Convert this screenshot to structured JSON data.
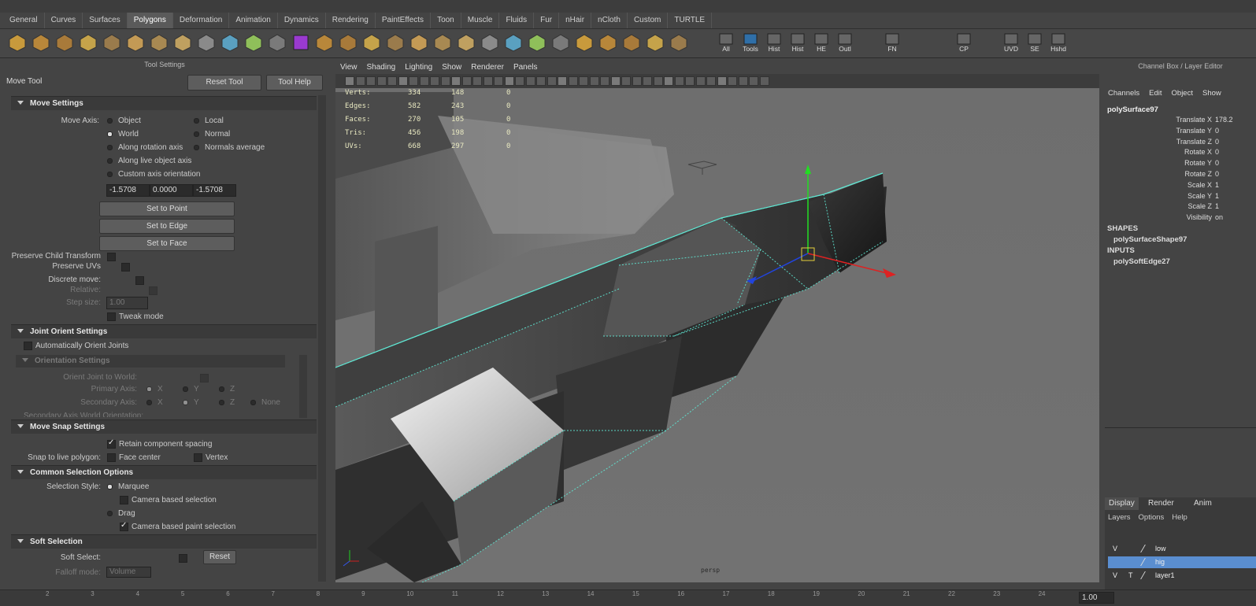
{
  "shelf_tabs": [
    "General",
    "Curves",
    "Surfaces",
    "Polygons",
    "Deformation",
    "Animation",
    "Dynamics",
    "Rendering",
    "PaintEffects",
    "Toon",
    "Muscle",
    "Fluids",
    "Fur",
    "nHair",
    "nCloth",
    "Custom",
    "TURTLE"
  ],
  "shelf_active": "Polygons",
  "shelf_labels": [
    "All",
    "Tools",
    "Hist",
    "Hist",
    "HE",
    "Outl",
    "FN",
    "CP",
    "UVD",
    "SE",
    "Hshd"
  ],
  "tool_settings": {
    "panel_title": "Tool Settings",
    "tool_name": "Move Tool",
    "reset_tool": "Reset Tool",
    "tool_help": "Tool Help",
    "move_settings": {
      "title": "Move Settings",
      "move_axis_label": "Move Axis:",
      "object": "Object",
      "local": "Local",
      "world": "World",
      "normal": "Normal",
      "along_rotation": "Along rotation axis",
      "normals_average": "Normals average",
      "along_live": "Along live object axis",
      "custom_axis": "Custom axis orientation",
      "v1": "-1.5708",
      "v2": "0.0000",
      "v3": "-1.5708",
      "set_to_point": "Set to Point",
      "set_to_edge": "Set to Edge",
      "set_to_face": "Set to Face",
      "preserve_child": "Preserve Child Transform",
      "preserve_uvs": "Preserve UVs",
      "discrete_move": "Discrete move:",
      "relative": "Relative:",
      "step_size": "Step size:",
      "step_value": "1.00",
      "tweak_mode": "Tweak mode"
    },
    "joint_orient": {
      "title": "Joint Orient Settings",
      "auto_orient": "Automatically Orient Joints",
      "orientation_settings": "Orientation Settings",
      "orient_world": "Orient Joint to World:",
      "primary_axis": "Primary Axis:",
      "secondary_axis": "Secondary Axis:",
      "x": "X",
      "y": "Y",
      "z": "Z",
      "none": "None",
      "secondary_world": "Secondary Axis World Orientation:"
    },
    "move_snap": {
      "title": "Move Snap Settings",
      "retain_spacing": "Retain component spacing",
      "snap_live": "Snap to live polygon:",
      "face_center": "Face center",
      "vertex": "Vertex"
    },
    "common_selection": {
      "title": "Common Selection Options",
      "selection_style": "Selection Style:",
      "marquee": "Marquee",
      "camera_based": "Camera based selection",
      "drag": "Drag",
      "camera_paint": "Camera based paint selection"
    },
    "soft_selection": {
      "title": "Soft Selection",
      "soft_select": "Soft Select:",
      "reset": "Reset",
      "falloff_mode": "Falloff mode:",
      "falloff_value": "Volume"
    }
  },
  "viewport": {
    "menus": [
      "View",
      "Shading",
      "Lighting",
      "Show",
      "Renderer",
      "Panels"
    ],
    "hud": [
      {
        "label": "Verts:",
        "a": "334",
        "b": "148",
        "c": "0"
      },
      {
        "label": "Edges:",
        "a": "582",
        "b": "243",
        "c": "0"
      },
      {
        "label": "Faces:",
        "a": "270",
        "b": "105",
        "c": "0"
      },
      {
        "label": "Tris:",
        "a": "456",
        "b": "198",
        "c": "0"
      },
      {
        "label": "UVs:",
        "a": "668",
        "b": "297",
        "c": "0"
      }
    ],
    "camera": "persp"
  },
  "channel_box": {
    "title": "Channel Box / Layer Editor",
    "menus": [
      "Channels",
      "Edit",
      "Object",
      "Show"
    ],
    "object_name": "polySurface97",
    "attrs": [
      {
        "name": "Translate X",
        "value": "178.2"
      },
      {
        "name": "Translate Y",
        "value": "0"
      },
      {
        "name": "Translate Z",
        "value": "0"
      },
      {
        "name": "Rotate X",
        "value": "0"
      },
      {
        "name": "Rotate Y",
        "value": "0"
      },
      {
        "name": "Rotate Z",
        "value": "0"
      },
      {
        "name": "Scale X",
        "value": "1"
      },
      {
        "name": "Scale Y",
        "value": "1"
      },
      {
        "name": "Scale Z",
        "value": "1"
      },
      {
        "name": "Visibility",
        "value": "on"
      }
    ],
    "shapes_label": "SHAPES",
    "shape_name": "polySurfaceShape97",
    "inputs_label": "INPUTS",
    "input_name": "polySoftEdge27"
  },
  "layer_editor": {
    "tabs": [
      "Display",
      "Render",
      "Anim"
    ],
    "menus": [
      "Layers",
      "Options",
      "Help"
    ],
    "layers": [
      {
        "v": "V",
        "t": "",
        "name": "low",
        "selected": false
      },
      {
        "v": "",
        "t": "",
        "name": "hig",
        "selected": true
      },
      {
        "v": "V",
        "t": "T",
        "name": "layer1",
        "selected": false
      }
    ]
  },
  "timeline": {
    "ticks": [
      "2",
      "3",
      "4",
      "5",
      "6",
      "7",
      "8",
      "9",
      "10",
      "11",
      "12",
      "13",
      "14",
      "15",
      "16",
      "17",
      "18",
      "19",
      "20",
      "21",
      "22",
      "23",
      "24"
    ],
    "current": "1.00"
  },
  "colors": {
    "wire": "#5fe8d4",
    "selected_layer": "#5a8ed0",
    "accent": "#3a7fd4"
  }
}
